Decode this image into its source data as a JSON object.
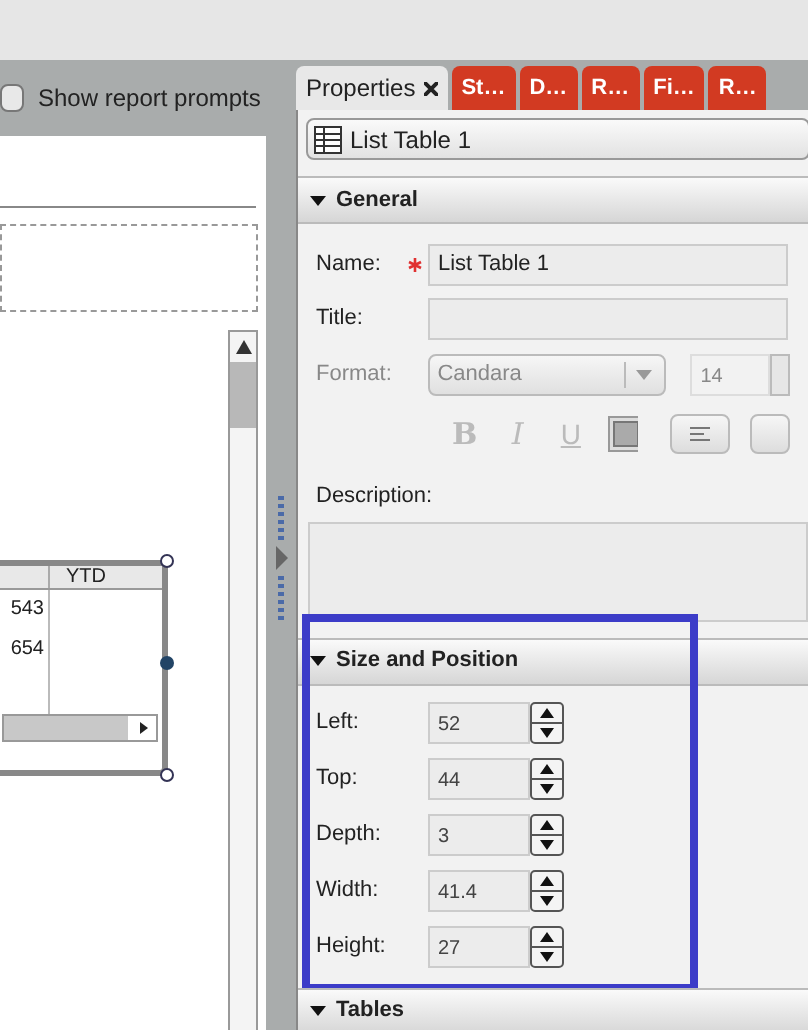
{
  "prompts_toggle": {
    "label": "Show report prompts",
    "checked": false
  },
  "canvas": {
    "table": {
      "column_2": "YTD",
      "rows": [
        {
          "column_1": "543"
        },
        {
          "column_1": "654"
        }
      ]
    }
  },
  "tabs": [
    {
      "label": "Properties",
      "selected": true,
      "closable": true
    },
    {
      "label": "St…",
      "selected": false,
      "closable": false
    },
    {
      "label": "D…",
      "selected": false,
      "closable": false
    },
    {
      "label": "R…",
      "selected": false,
      "closable": false
    },
    {
      "label": "Fi…",
      "selected": false,
      "closable": false
    },
    {
      "label": "R…",
      "selected": false,
      "closable": false
    }
  ],
  "object_selector": {
    "value": "List Table 1"
  },
  "sections": [
    {
      "kind": "general",
      "title": "General",
      "expanded": true,
      "highlighted": false,
      "name": {
        "label": "Name:",
        "required": true,
        "value": "List Table 1"
      },
      "title_field": {
        "label": "Title:"
      },
      "format": {
        "label": "Format:",
        "disabled": true,
        "font": "Candara",
        "size": "14",
        "style_buttons": [
          "B",
          "I",
          "U"
        ]
      },
      "description": {
        "label": "Description:"
      }
    },
    {
      "kind": "size",
      "title": "Size and Position",
      "expanded": true,
      "highlighted": true,
      "fields": [
        {
          "label": "Left:",
          "value": "52"
        },
        {
          "label": "Top:",
          "value": "44"
        },
        {
          "label": "Depth:",
          "value": "3"
        },
        {
          "label": "Width:",
          "value": "41.4"
        },
        {
          "label": "Height:",
          "value": "27"
        }
      ]
    },
    {
      "kind": "plain",
      "title": "Tables",
      "expanded": true,
      "highlighted": false
    }
  ]
}
